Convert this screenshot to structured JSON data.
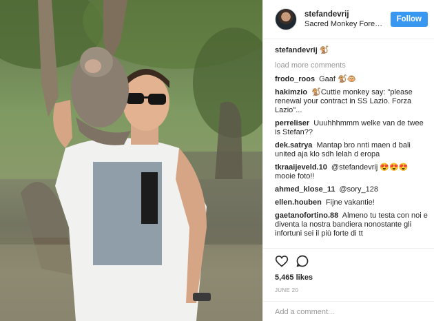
{
  "post": {
    "username": "stefandevrij",
    "location": "Sacred Monkey Forest ...",
    "follow_label": "Follow",
    "caption_user": "stefandevrij",
    "caption_text": "🐒",
    "load_more": "load more comments",
    "comments": [
      {
        "user": "frodo_roos",
        "text": "Gaaf 🐒🐵"
      },
      {
        "user": "hakimzio",
        "text": "🐒Cuttie monkey say: \"please renewal your contract in SS Lazio. Forza Lazio\"..."
      },
      {
        "user": "perreliser",
        "text": "Uuuhhhmmm welke van de twee is Stefan??"
      },
      {
        "user": "dek.satrya",
        "text": "Mantap bro nnti maen d bali united aja klo sdh lelah d eropa"
      },
      {
        "user": "tkraaijeveld.10",
        "text": "@stefandevrij 😍😍😍mooie foto!!"
      },
      {
        "user": "ahmed_klose_11",
        "text": "@sory_128"
      },
      {
        "user": "ellen.houben",
        "text": "Fijne vakantie!"
      },
      {
        "user": "gaetanofortino.88",
        "text": "Almeno tu testa con noi e diventa la nostra bandiera nonostante gli infortuni sei il più forte di tt"
      }
    ],
    "likes": "5,465 likes",
    "date": "JUNE 20",
    "add_comment_placeholder": "Add a comment..."
  },
  "icons": {
    "like": "heart-outline-icon",
    "comment": "speech-bubble-icon"
  },
  "colors": {
    "follow_bg": "#3897f0",
    "muted": "#999999",
    "border": "#efefef"
  }
}
